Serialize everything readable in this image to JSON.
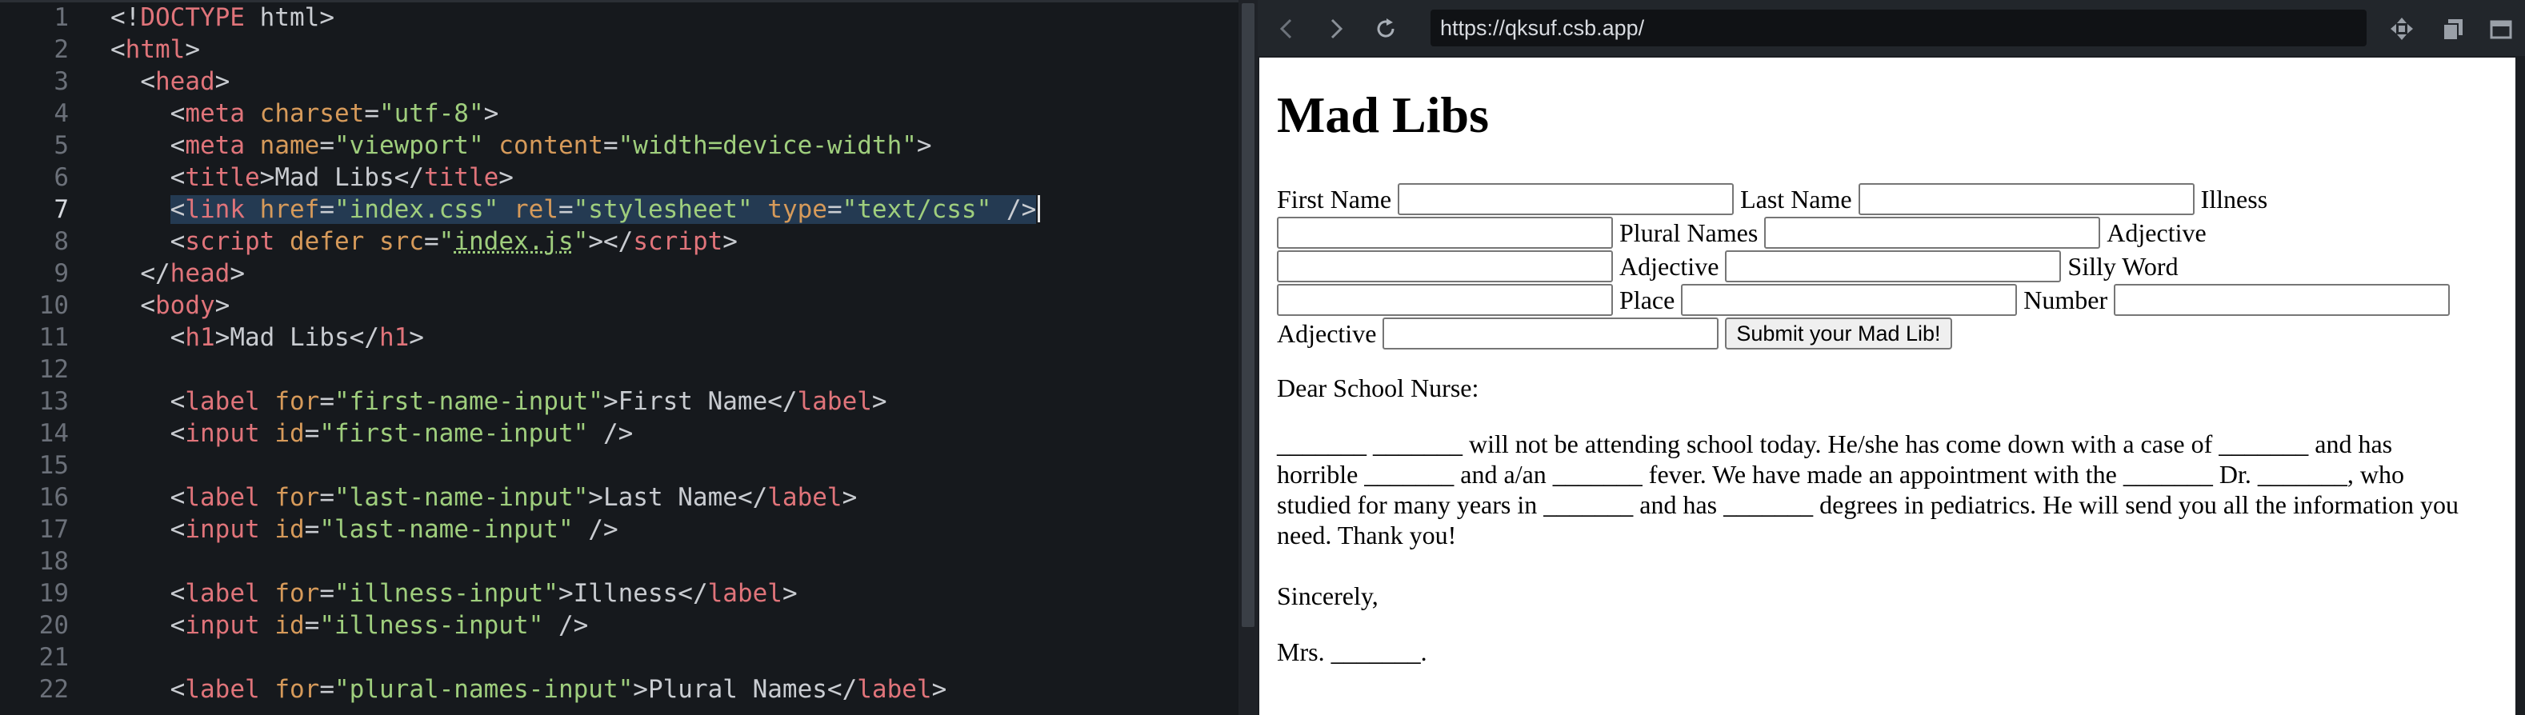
{
  "editor": {
    "line_numbers": [
      "1",
      "2",
      "3",
      "4",
      "5",
      "6",
      "7",
      "8",
      "9",
      "10",
      "11",
      "12",
      "13",
      "14",
      "15",
      "16",
      "17",
      "18",
      "19",
      "20",
      "21",
      "22"
    ],
    "lines": [
      [
        [
          "t-punct",
          "<!"
        ],
        [
          "t-doctype",
          "DOCTYPE"
        ],
        [
          "t-text",
          " html"
        ],
        [
          "t-punct",
          ">"
        ]
      ],
      [
        [
          "t-punct",
          "<"
        ],
        [
          "t-tag",
          "html"
        ],
        [
          "t-punct",
          ">"
        ]
      ],
      [
        [
          "t-text",
          "  "
        ],
        [
          "t-punct",
          "<"
        ],
        [
          "t-tag",
          "head"
        ],
        [
          "t-punct",
          ">"
        ]
      ],
      [
        [
          "t-text",
          "    "
        ],
        [
          "t-punct",
          "<"
        ],
        [
          "t-tag",
          "meta"
        ],
        [
          "t-text",
          " "
        ],
        [
          "t-attr",
          "charset"
        ],
        [
          "t-punct",
          "="
        ],
        [
          "t-str",
          "\"utf-8\""
        ],
        [
          "t-punct",
          ">"
        ]
      ],
      [
        [
          "t-text",
          "    "
        ],
        [
          "t-punct",
          "<"
        ],
        [
          "t-tag",
          "meta"
        ],
        [
          "t-text",
          " "
        ],
        [
          "t-attr",
          "name"
        ],
        [
          "t-punct",
          "="
        ],
        [
          "t-str",
          "\"viewport\""
        ],
        [
          "t-text",
          " "
        ],
        [
          "t-attr",
          "content"
        ],
        [
          "t-punct",
          "="
        ],
        [
          "t-str",
          "\"width=device-width\""
        ],
        [
          "t-punct",
          ">"
        ]
      ],
      [
        [
          "t-text",
          "    "
        ],
        [
          "t-punct",
          "<"
        ],
        [
          "t-tag",
          "title"
        ],
        [
          "t-punct",
          ">"
        ],
        [
          "t-text",
          "Mad Libs"
        ],
        [
          "t-punct",
          "</"
        ],
        [
          "t-tag",
          "title"
        ],
        [
          "t-punct",
          ">"
        ]
      ],
      [
        [
          "t-text",
          "    "
        ],
        [
          "t-punct",
          "<"
        ],
        [
          "t-tag",
          "link"
        ],
        [
          "t-text",
          " "
        ],
        [
          "t-attr",
          "href"
        ],
        [
          "t-punct",
          "="
        ],
        [
          "t-str",
          "\"index.css\""
        ],
        [
          "t-text",
          " "
        ],
        [
          "t-attr",
          "rel"
        ],
        [
          "t-punct",
          "="
        ],
        [
          "t-str",
          "\"stylesheet\""
        ],
        [
          "t-text",
          " "
        ],
        [
          "t-attr",
          "type"
        ],
        [
          "t-punct",
          "="
        ],
        [
          "t-str",
          "\"text/css\""
        ],
        [
          "t-text",
          " "
        ],
        [
          "t-punct",
          "/>"
        ]
      ],
      [
        [
          "t-text",
          "    "
        ],
        [
          "t-punct",
          "<"
        ],
        [
          "t-tag",
          "script"
        ],
        [
          "t-text",
          " "
        ],
        [
          "t-attr",
          "defer"
        ],
        [
          "t-text",
          " "
        ],
        [
          "t-attr",
          "src"
        ],
        [
          "t-punct",
          "="
        ],
        [
          "t-str",
          "\""
        ],
        [
          "t-str underline",
          "index.js"
        ],
        [
          "t-str",
          "\""
        ],
        [
          "t-punct",
          "></"
        ],
        [
          "t-tag",
          "script"
        ],
        [
          "t-punct",
          ">"
        ]
      ],
      [
        [
          "t-text",
          "  "
        ],
        [
          "t-punct",
          "</"
        ],
        [
          "t-tag",
          "head"
        ],
        [
          "t-punct",
          ">"
        ]
      ],
      [
        [
          "t-text",
          "  "
        ],
        [
          "t-punct",
          "<"
        ],
        [
          "t-tag",
          "body"
        ],
        [
          "t-punct",
          ">"
        ]
      ],
      [
        [
          "t-text",
          "    "
        ],
        [
          "t-punct",
          "<"
        ],
        [
          "t-tag",
          "h1"
        ],
        [
          "t-punct",
          ">"
        ],
        [
          "t-text",
          "Mad Libs"
        ],
        [
          "t-punct",
          "</"
        ],
        [
          "t-tag",
          "h1"
        ],
        [
          "t-punct",
          ">"
        ]
      ],
      [],
      [
        [
          "t-text",
          "    "
        ],
        [
          "t-punct",
          "<"
        ],
        [
          "t-tag",
          "label"
        ],
        [
          "t-text",
          " "
        ],
        [
          "t-attr",
          "for"
        ],
        [
          "t-punct",
          "="
        ],
        [
          "t-str",
          "\"first-name-input\""
        ],
        [
          "t-punct",
          ">"
        ],
        [
          "t-text",
          "First Name"
        ],
        [
          "t-punct",
          "</"
        ],
        [
          "t-tag",
          "label"
        ],
        [
          "t-punct",
          ">"
        ]
      ],
      [
        [
          "t-text",
          "    "
        ],
        [
          "t-punct",
          "<"
        ],
        [
          "t-tag",
          "input"
        ],
        [
          "t-text",
          " "
        ],
        [
          "t-attr",
          "id"
        ],
        [
          "t-punct",
          "="
        ],
        [
          "t-str",
          "\"first-name-input\""
        ],
        [
          "t-text",
          " "
        ],
        [
          "t-punct",
          "/>"
        ]
      ],
      [],
      [
        [
          "t-text",
          "    "
        ],
        [
          "t-punct",
          "<"
        ],
        [
          "t-tag",
          "label"
        ],
        [
          "t-text",
          " "
        ],
        [
          "t-attr",
          "for"
        ],
        [
          "t-punct",
          "="
        ],
        [
          "t-str",
          "\"last-name-input\""
        ],
        [
          "t-punct",
          ">"
        ],
        [
          "t-text",
          "Last Name"
        ],
        [
          "t-punct",
          "</"
        ],
        [
          "t-tag",
          "label"
        ],
        [
          "t-punct",
          ">"
        ]
      ],
      [
        [
          "t-text",
          "    "
        ],
        [
          "t-punct",
          "<"
        ],
        [
          "t-tag",
          "input"
        ],
        [
          "t-text",
          " "
        ],
        [
          "t-attr",
          "id"
        ],
        [
          "t-punct",
          "="
        ],
        [
          "t-str",
          "\"last-name-input\""
        ],
        [
          "t-text",
          " "
        ],
        [
          "t-punct",
          "/>"
        ]
      ],
      [],
      [
        [
          "t-text",
          "    "
        ],
        [
          "t-punct",
          "<"
        ],
        [
          "t-tag",
          "label"
        ],
        [
          "t-text",
          " "
        ],
        [
          "t-attr",
          "for"
        ],
        [
          "t-punct",
          "="
        ],
        [
          "t-str",
          "\"illness-input\""
        ],
        [
          "t-punct",
          ">"
        ],
        [
          "t-text",
          "Illness"
        ],
        [
          "t-punct",
          "</"
        ],
        [
          "t-tag",
          "label"
        ],
        [
          "t-punct",
          ">"
        ]
      ],
      [
        [
          "t-text",
          "    "
        ],
        [
          "t-punct",
          "<"
        ],
        [
          "t-tag",
          "input"
        ],
        [
          "t-text",
          " "
        ],
        [
          "t-attr",
          "id"
        ],
        [
          "t-punct",
          "="
        ],
        [
          "t-str",
          "\"illness-input\""
        ],
        [
          "t-text",
          " "
        ],
        [
          "t-punct",
          "/>"
        ]
      ],
      [],
      [
        [
          "t-text",
          "    "
        ],
        [
          "t-punct",
          "<"
        ],
        [
          "t-tag",
          "label"
        ],
        [
          "t-text",
          " "
        ],
        [
          "t-attr",
          "for"
        ],
        [
          "t-punct",
          "="
        ],
        [
          "t-str",
          "\"plural-names-input\""
        ],
        [
          "t-punct",
          ">"
        ],
        [
          "t-text",
          "Plural Names"
        ],
        [
          "t-punct",
          "</"
        ],
        [
          "t-tag",
          "label"
        ],
        [
          "t-punct",
          ">"
        ]
      ]
    ],
    "active_line": 7
  },
  "browser": {
    "url": "https://qksuf.csb.app/",
    "icons": {
      "back": "chevron-left-icon",
      "forward": "chevron-right-icon",
      "reload": "reload-icon",
      "move": "move-icon",
      "copy": "copy-icon",
      "window": "window-icon"
    }
  },
  "page": {
    "title": "Mad Libs",
    "labels": {
      "first_name": "First Name",
      "last_name": "Last Name",
      "illness": "Illness",
      "plural_names": "Plural Names",
      "adjective_1": "Adjective",
      "adjective_2": "Adjective",
      "silly_word": "Silly Word",
      "place": "Place",
      "number": "Number",
      "adjective_3": "Adjective"
    },
    "submit_label": "Submit your Mad Lib!",
    "greeting": "Dear School Nurse:",
    "story": "_______ _______ will not be attending school today. He/she has come down with a case of _______ and has horrible _______ and a/an _______ fever. We have made an appointment with the _______ Dr. _______, who studied for many years in _______ and has _______ degrees in pediatrics. He will send you all the information you need. Thank you!",
    "closing": "Sincerely,",
    "signature": "Mrs. _______."
  }
}
